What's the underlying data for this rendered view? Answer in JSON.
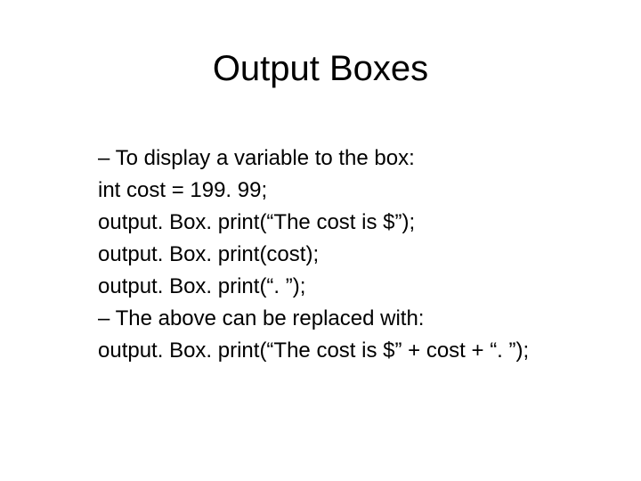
{
  "slide": {
    "title": "Output Boxes",
    "body": {
      "lines": [
        "– To display a variable to the box:",
        "int cost = 199. 99;",
        "output. Box. print(“The cost is $”);",
        "output. Box. print(cost);",
        "output. Box. print(“. ”);",
        "– The above can be replaced with:",
        "output. Box. print(“The cost is $” + cost + “. ”);"
      ]
    }
  }
}
